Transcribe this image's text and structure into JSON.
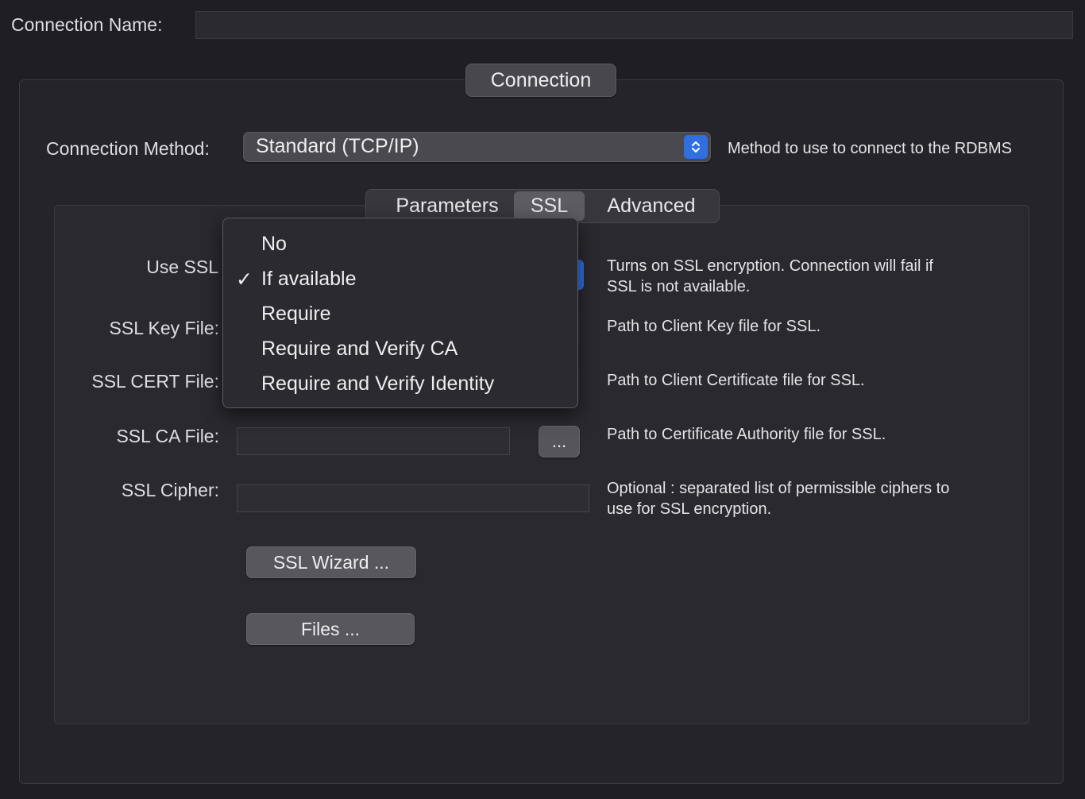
{
  "connection_name": {
    "label": "Connection Name:",
    "value": ""
  },
  "group": {
    "title": "Connection"
  },
  "connection_method": {
    "label": "Connection Method:",
    "value": "Standard (TCP/IP)",
    "help": "Method to use to connect to the RDBMS"
  },
  "tabs": [
    {
      "label": "Parameters",
      "active": false
    },
    {
      "label": "SSL",
      "active": true
    },
    {
      "label": "Advanced",
      "active": false
    }
  ],
  "ssl_form": {
    "use_ssl": {
      "label": "Use SSL",
      "help_line1": "Turns on SSL encryption. Connection will fail if",
      "help_line2": "SSL is not available."
    },
    "key_file": {
      "label": "SSL Key File:",
      "help": "Path to Client Key file for SSL."
    },
    "cert_file": {
      "label": "SSL CERT File:",
      "help": "Path to Client Certificate file for SSL."
    },
    "ca_file": {
      "label": "SSL CA File:",
      "value": "",
      "browse_label": "...",
      "help": "Path to Certificate Authority file for SSL."
    },
    "cipher": {
      "label": "SSL Cipher:",
      "value": "",
      "help_line1": "Optional : separated list of permissible ciphers to",
      "help_line2": "use for SSL encryption."
    },
    "wizard_button": "SSL Wizard ...",
    "files_button": "Files ..."
  },
  "use_ssl_menu": {
    "options": [
      "No",
      "If available",
      "Require",
      "Require and Verify CA",
      "Require and Verify Identity"
    ],
    "selected": "If available",
    "checkmark": "✓"
  }
}
